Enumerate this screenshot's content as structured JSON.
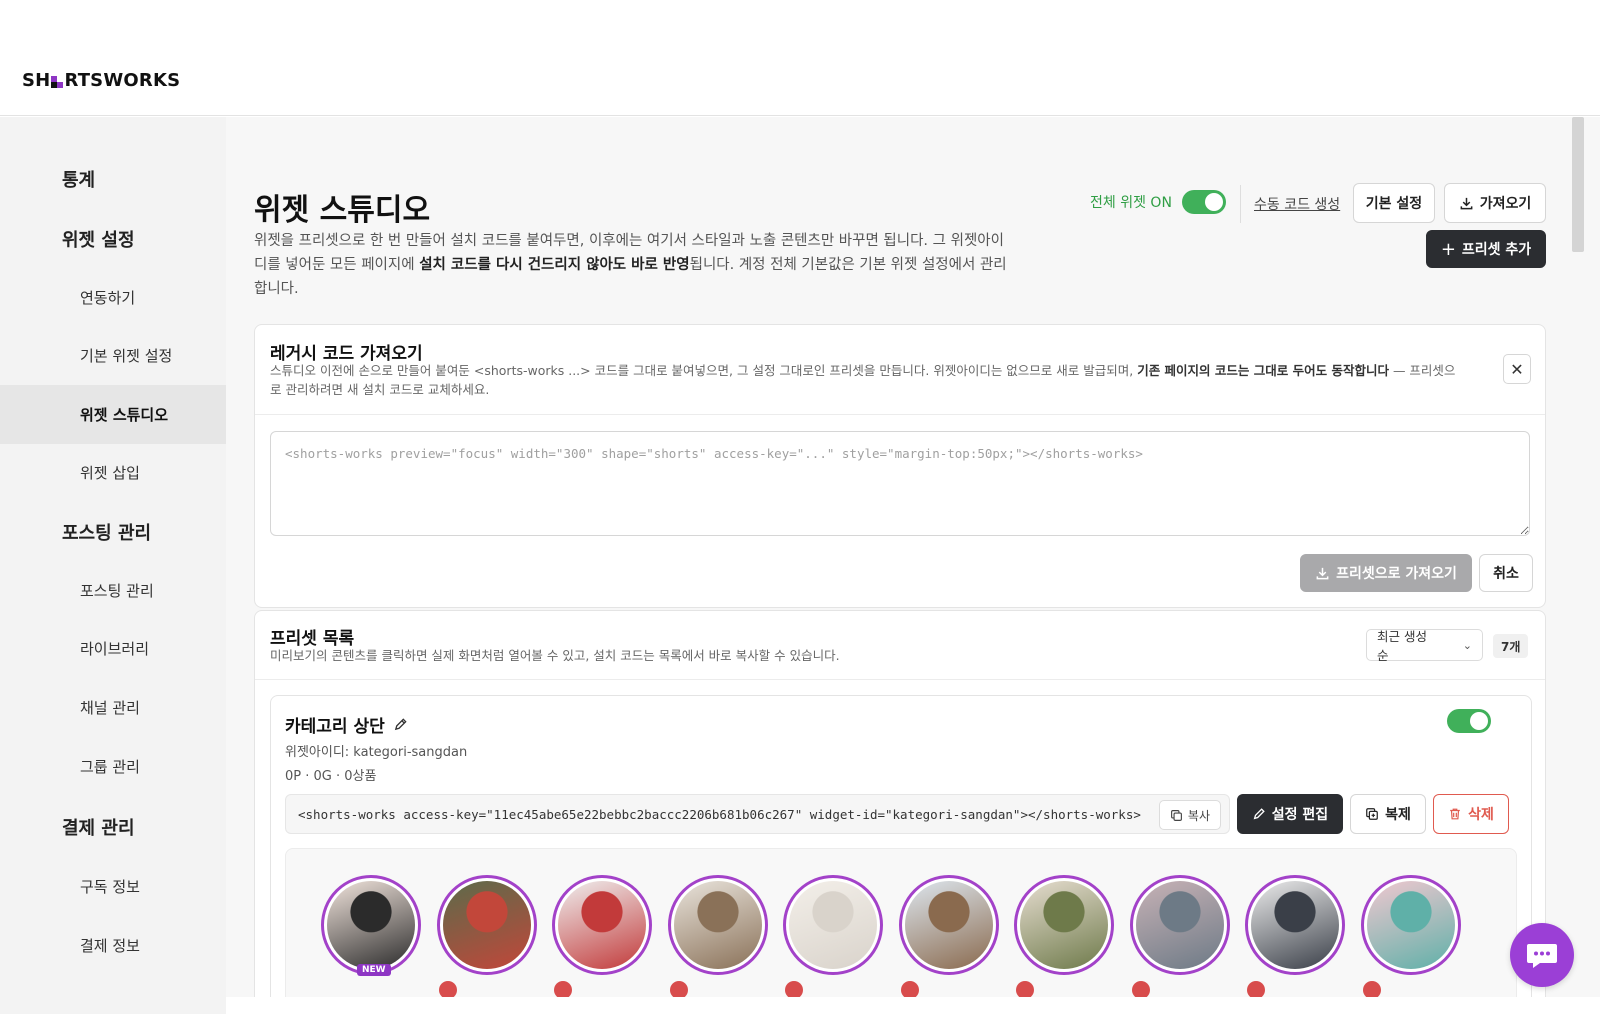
{
  "brand": {
    "logo_text_left": "SH",
    "logo_text_right": "RTSWORKS",
    "accent": "#8e36c4"
  },
  "sidebar": {
    "items": [
      {
        "label": "통계",
        "kind": "group"
      },
      {
        "label": "위젯 설정",
        "kind": "group"
      },
      {
        "label": "연동하기",
        "kind": "sub"
      },
      {
        "label": "기본 위젯 설정",
        "kind": "sub"
      },
      {
        "label": "위젯 스튜디오",
        "kind": "sub",
        "active": true
      },
      {
        "label": "위젯 삽입",
        "kind": "sub"
      },
      {
        "label": "포스팅 관리",
        "kind": "group"
      },
      {
        "label": "포스팅 관리",
        "kind": "sub"
      },
      {
        "label": "라이브러리",
        "kind": "sub"
      },
      {
        "label": "채널 관리",
        "kind": "sub"
      },
      {
        "label": "그룹 관리",
        "kind": "sub"
      },
      {
        "label": "결제 관리",
        "kind": "group"
      },
      {
        "label": "구독 정보",
        "kind": "sub"
      },
      {
        "label": "결제 정보",
        "kind": "sub"
      }
    ]
  },
  "header": {
    "title": "위젯 스튜디오",
    "description_1": "위젯을 프리셋으로 한 번 만들어 설치 코드를 붙여두면, 이후에는 여기서 스타일과 노출 콘텐츠만 바꾸면 됩니다. 그 위젯아이디를 넣어둔 모든 페이지에 ",
    "description_bold": "설치 코드를 다시 건드리지 않아도 바로 반영",
    "description_2": "됩니다. 계정 전체 기본값은 기본 위젯 설정에서 관리합니다.",
    "global_toggle_label": "전체 위젯 ON",
    "global_toggle_on": true,
    "manual_code_link": "수동 코드 생성",
    "default_settings_button": "기본 설정",
    "import_button": "가져오기",
    "add_preset_button": "프리셋 추가"
  },
  "legacy": {
    "title": "레거시 코드 가져오기",
    "description_1": "스튜디오 이전에 손으로 만들어 붙여둔 <shorts-works ...> 코드를 그대로 붙여넣으면, 그 설정 그대로인 프리셋을 만듭니다. 위젯아이디는 없으므로 새로 발급되며, ",
    "description_bold": "기존 페이지의 코드는 그대로 두어도 동작합니다",
    "description_2": " — 프리셋으로 관리하려면 새 설치 코드로 교체하세요.",
    "placeholder": "<shorts-works preview=\"focus\" width=\"300\" shape=\"shorts\" access-key=\"...\" style=\"margin-top:50px;\"></shorts-works>",
    "import_as_preset_button": "프리셋으로 가져오기",
    "cancel_button": "취소",
    "close_label": "✕"
  },
  "preset_list": {
    "title": "프리셋 목록",
    "description": "미리보기의 콘텐츠를 클릭하면 실제 화면처럼 열어볼 수 있고, 설치 코드는 목록에서 바로 복사할 수 있습니다.",
    "sort_selected": "최근 생성순",
    "count": "7개",
    "presets": [
      {
        "name": "카테고리 상단",
        "widget_id_label": "위젯아이디: kategori-sangdan",
        "stats": "0P · 0G · 0상품",
        "enabled": true,
        "install_code": "<shorts-works access-key=\"11ec45abe65e22bebbc2baccc2206b681b06c267\" widget-id=\"kategori-sangdan\"></shorts-works>",
        "copy_button": "복사",
        "edit_button": "설정 편집",
        "duplicate_button": "복제",
        "delete_button": "삭제",
        "new_badge": "NEW",
        "thumbnails": [
          {
            "color_a": "#f1e4dc",
            "color_b": "#2b2b2b"
          },
          {
            "color_a": "#5b6b4a",
            "color_b": "#c2473a"
          },
          {
            "color_a": "#efefef",
            "color_b": "#c23a3a"
          },
          {
            "color_a": "#e9e4dc",
            "color_b": "#8a7158"
          },
          {
            "color_a": "#f3efe9",
            "color_b": "#d9d3cb"
          },
          {
            "color_a": "#dde6ee",
            "color_b": "#8a6a4e"
          },
          {
            "color_a": "#e6ddd0",
            "color_b": "#6e7a4a"
          },
          {
            "color_a": "#c7b2b6",
            "color_b": "#6d7a86"
          },
          {
            "color_a": "#ececec",
            "color_b": "#3a3f48"
          },
          {
            "color_a": "#f0c8d0",
            "color_b": "#5fb0a8"
          }
        ]
      }
    ]
  }
}
